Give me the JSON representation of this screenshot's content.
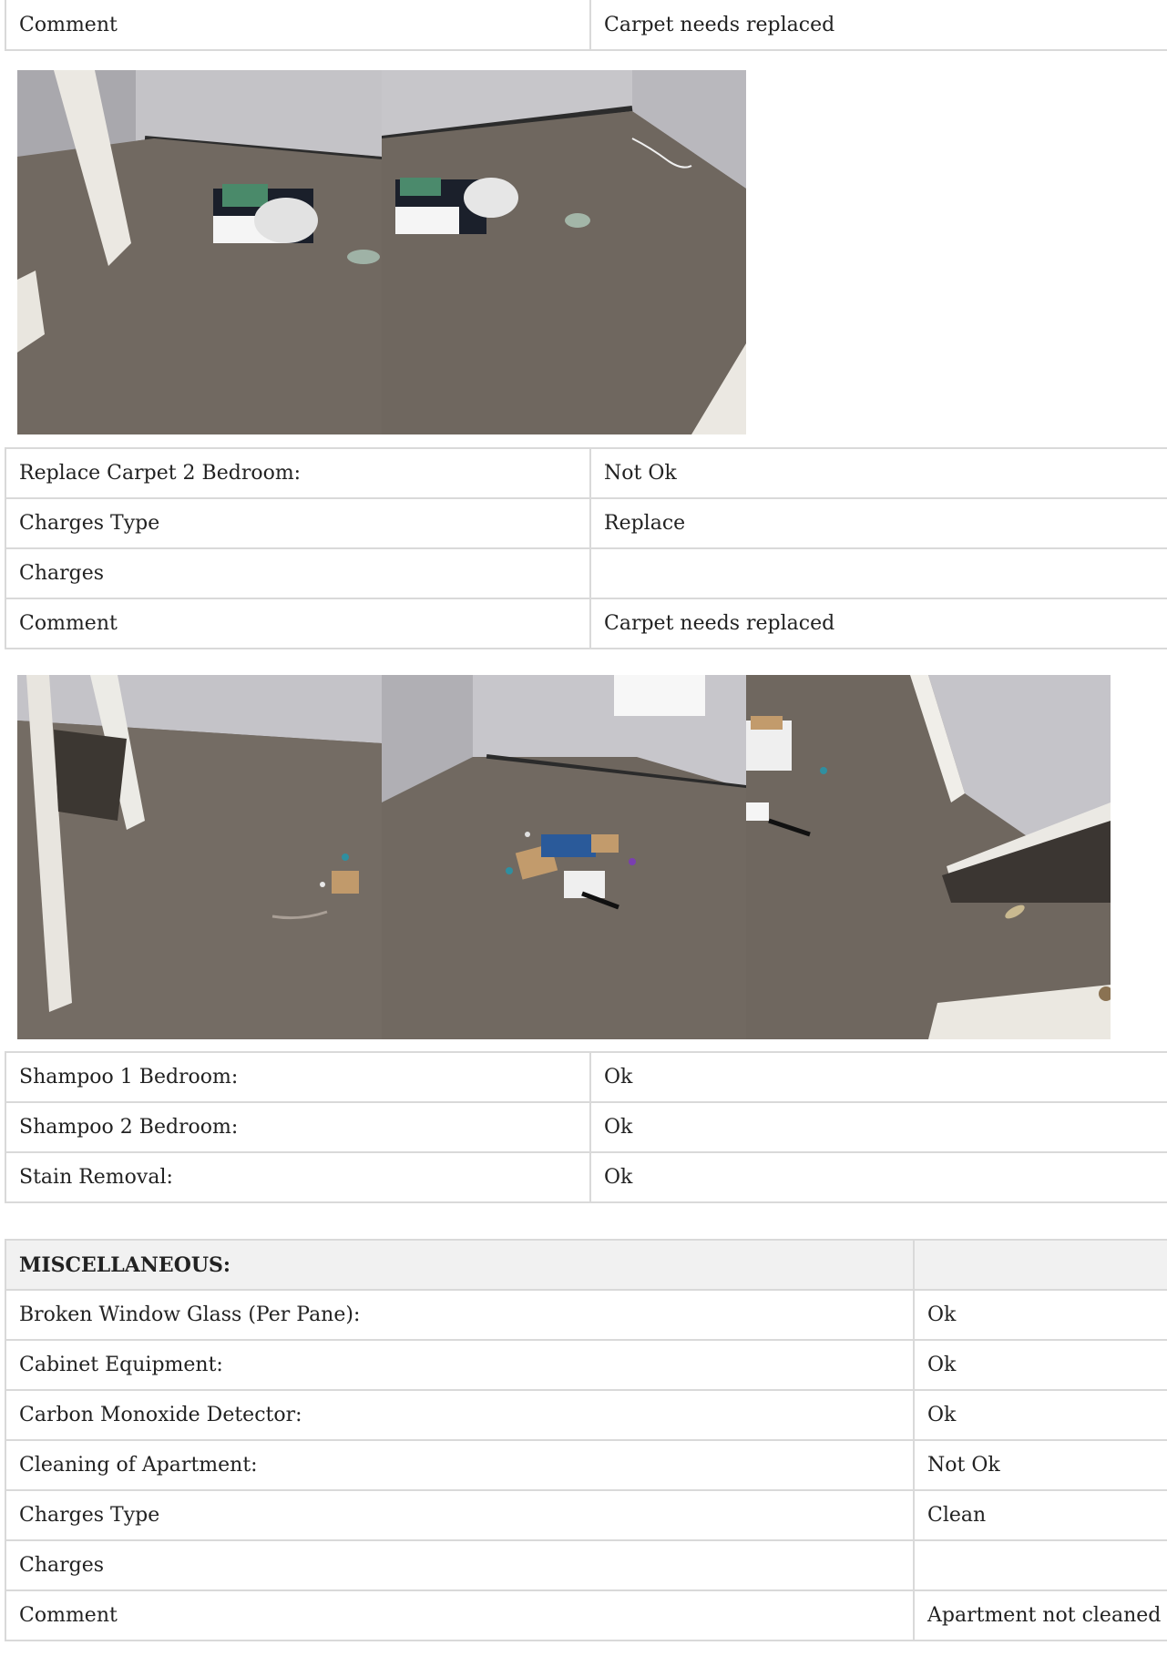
{
  "top_table": {
    "rows": [
      {
        "label": "Comment",
        "value": "Carpet needs replaced"
      }
    ]
  },
  "photos_group_1": [
    {
      "icon": "bedroom-carpet-photo"
    },
    {
      "icon": "bedroom-carpet-photo"
    }
  ],
  "carpet_table": {
    "rows": [
      {
        "label": "Replace Carpet 2 Bedroom:",
        "value": "Not Ok"
      },
      {
        "label": "Charges Type",
        "value": "Replace"
      },
      {
        "label": "Charges",
        "value": ""
      },
      {
        "label": "Comment",
        "value": "Carpet needs replaced"
      }
    ]
  },
  "photos_group_2": [
    {
      "icon": "bedroom-carpet-photo"
    },
    {
      "icon": "bedroom-carpet-photo"
    },
    {
      "icon": "bedroom-carpet-photo"
    }
  ],
  "shampoo_table": {
    "rows": [
      {
        "label": "Shampoo 1 Bedroom:",
        "value": "Ok"
      },
      {
        "label": "Shampoo 2 Bedroom:",
        "value": "Ok"
      },
      {
        "label": "Stain Removal:",
        "value": "Ok"
      }
    ]
  },
  "misc_table": {
    "header": "MISCELLANEOUS:",
    "header_value": "",
    "rows": [
      {
        "label": "Broken Window Glass (Per Pane):",
        "value": "Ok"
      },
      {
        "label": "Cabinet Equipment:",
        "value": "Ok"
      },
      {
        "label": "Carbon Monoxide Detector:",
        "value": "Ok"
      },
      {
        "label": "Cleaning of Apartment:",
        "value": "Not Ok"
      },
      {
        "label": "Charges Type",
        "value": "Clean"
      },
      {
        "label": "Charges",
        "value": ""
      },
      {
        "label": "Comment",
        "value": "Apartment not cleaned"
      }
    ]
  },
  "colors": {
    "border": "#d9d9d9",
    "header_bg": "#f1f1f1",
    "text": "#222222",
    "carpet": "#6e665f",
    "wall": "#c9c8cc"
  }
}
